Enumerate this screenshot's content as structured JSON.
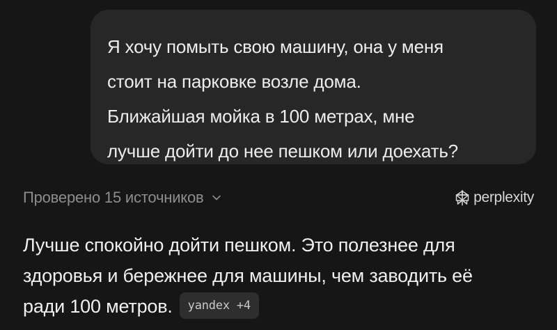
{
  "user_message": {
    "lines": [
      "Я хочу помыть свою машину, она у меня",
      "стоит на парковке возле дома.",
      "Ближайшая мойка в 100 метрах, мне",
      "лучше дойти до нее пешком или доехать?"
    ]
  },
  "sources": {
    "label": "Проверено 15 источников",
    "icon": "chevron-down-icon"
  },
  "brand": {
    "name": "perplexity",
    "icon": "perplexity-logo-icon"
  },
  "answer": {
    "lines": [
      "Лучше спокойно дойти пешком. Это полезнее для",
      "здоровья и бережнее для машины, чем заводить её",
      "ради 100 метров."
    ],
    "citation": {
      "source": "yandex",
      "extra": "+4"
    }
  },
  "colors": {
    "background": "#161616",
    "bubble": "#272727",
    "muted_text": "#8d8d8d",
    "citation_bg": "#2e2e2e"
  }
}
